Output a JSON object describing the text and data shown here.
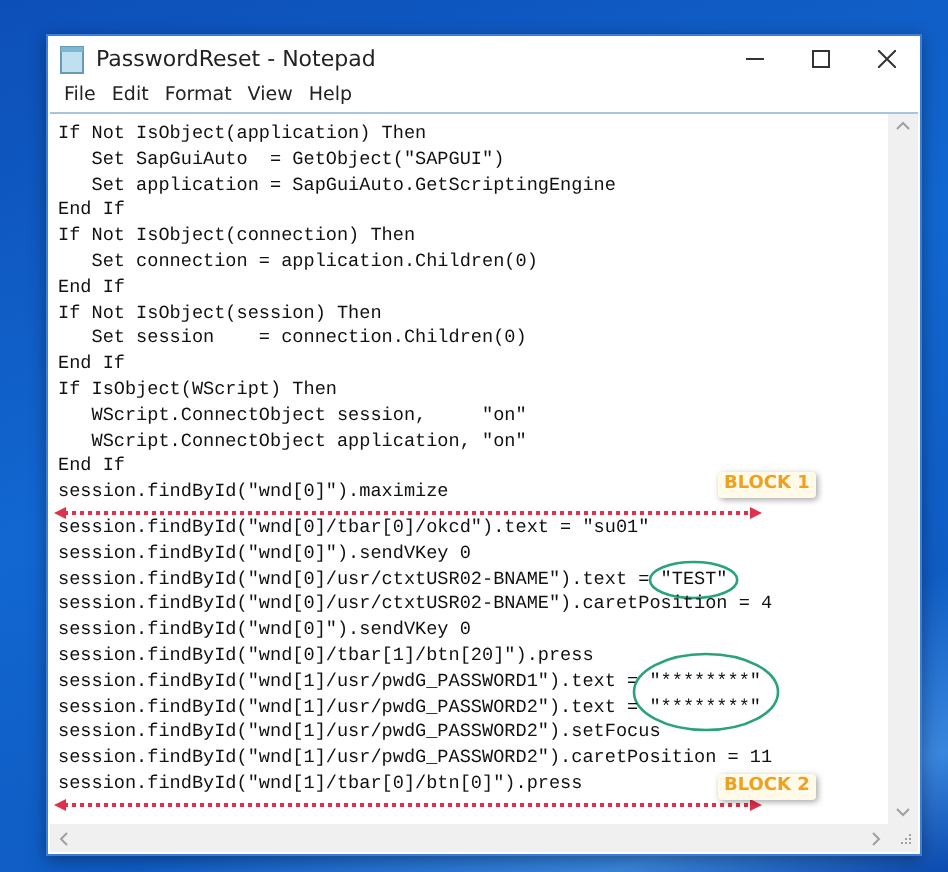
{
  "window": {
    "title": "PasswordReset - Notepad"
  },
  "menu": [
    "File",
    "Edit",
    "Format",
    "View",
    "Help"
  ],
  "lines": [
    {
      "text": "If Not IsObject(application) Then"
    },
    {
      "text": "   Set SapGuiAuto  = GetObject(\"SAPGUI\")"
    },
    {
      "text": "   Set application = SapGuiAuto.GetScriptingEngine"
    },
    {
      "text": "End If"
    },
    {
      "text": "If Not IsObject(connection) Then"
    },
    {
      "text": "   Set connection = application.Children(0)"
    },
    {
      "text": "End If"
    },
    {
      "text": "If Not IsObject(session) Then"
    },
    {
      "text": "   Set session    = connection.Children(0)"
    },
    {
      "text": "End If"
    },
    {
      "text": "If IsObject(WScript) Then"
    },
    {
      "text": "   WScript.ConnectObject session,     \"on\""
    },
    {
      "text": "   WScript.ConnectObject application, \"on\""
    },
    {
      "text": "End If"
    },
    {
      "text": "session.findById(\"wnd[0]\").maximize",
      "block_label": "BLOCK 1"
    },
    {
      "text": "session.findById(\"wnd[0]/tbar[0]/okcd\").text = \"su01\""
    },
    {
      "text": "session.findById(\"wnd[0]\").sendVKey 0"
    },
    {
      "text": "session.findById(\"wnd[0]/usr/ctxtUSR02-BNAME\").text = ",
      "circled": "\"TEST\""
    },
    {
      "text": "session.findById(\"wnd[0]/usr/ctxtUSR02-BNAME\").caretPosition = 4"
    },
    {
      "text": "session.findById(\"wnd[0]\").sendVKey 0"
    },
    {
      "text": "session.findById(\"wnd[0]/tbar[1]/btn[20]\").press"
    },
    {
      "text": "session.findById(\"wnd[1]/usr/pwdG_PASSWORD1\").text = ",
      "circled": "\"********\""
    },
    {
      "text": "session.findById(\"wnd[1]/usr/pwdG_PASSWORD2\").text = ",
      "circled": "\"********\""
    },
    {
      "text": "session.findById(\"wnd[1]/usr/pwdG_PASSWORD2\").setFocus"
    },
    {
      "text": "session.findById(\"wnd[1]/usr/pwdG_PASSWORD2\").caretPosition = 11"
    },
    {
      "text": "session.findById(\"wnd[1]/tbar[0]/btn[0]\").press",
      "block_label": "BLOCK 2"
    }
  ]
}
